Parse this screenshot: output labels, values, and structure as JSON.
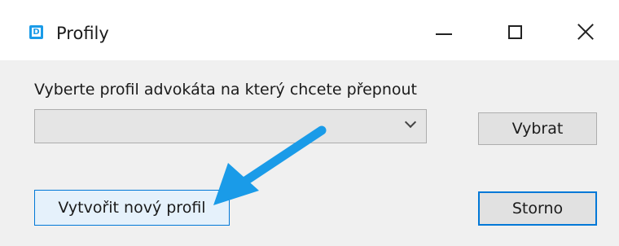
{
  "window": {
    "title": "Profily",
    "icon_letter": "D",
    "controls": {
      "minimize": "minimize-icon",
      "maximize": "maximize-icon",
      "close": "close-icon"
    }
  },
  "dialog": {
    "prompt": "Vyberte profil advokáta na který chcete přepnout",
    "profile_select": {
      "selected_value": ""
    },
    "select_button_label": "Vybrat",
    "create_button_label": "Vytvořit nový profil",
    "cancel_button_label": "Storno"
  },
  "annotation": {
    "arrow_color": "#1a9be8"
  },
  "colors": {
    "accent": "#0078d7",
    "app_icon": "#1a9be8",
    "client_bg": "#f0f0f0"
  }
}
